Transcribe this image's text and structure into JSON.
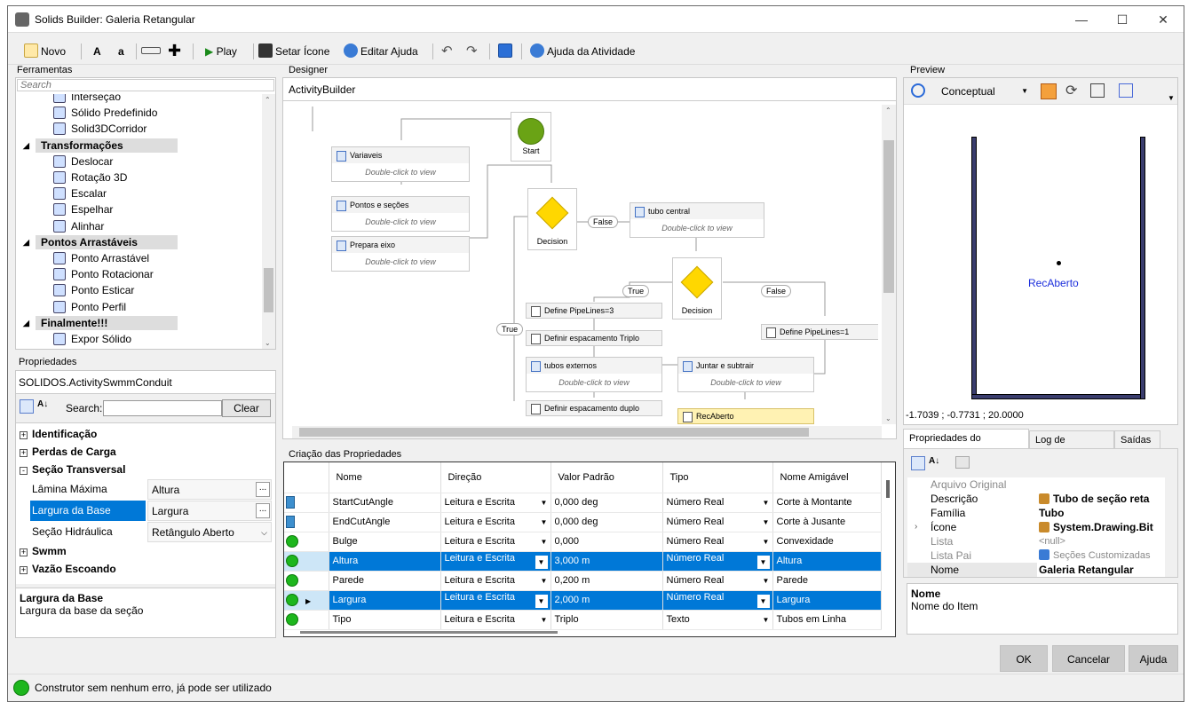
{
  "window": {
    "title": "Solids Builder: Galeria Retangular"
  },
  "toolbar": {
    "novo": "Novo",
    "a_upper": "A",
    "a_lower": "a",
    "play": "Play",
    "setar_icone": "Setar Ícone",
    "editar_ajuda": "Editar Ajuda",
    "ajuda_atividade": "Ajuda da Atividade"
  },
  "ferramentas": {
    "title": "Ferramentas",
    "search_placeholder": "Search",
    "items": [
      {
        "kind": "item",
        "label": "Interseção",
        "icon": "intersect-icon"
      },
      {
        "kind": "item",
        "label": "Sólido Predefinido",
        "icon": "solid-icon"
      },
      {
        "kind": "item",
        "label": "Solid3DCorridor",
        "icon": "gear-icon"
      },
      {
        "kind": "cat",
        "label": "Transformações"
      },
      {
        "kind": "item",
        "label": "Deslocar",
        "icon": "move-icon"
      },
      {
        "kind": "item",
        "label": "Rotação 3D",
        "icon": "rotate-icon"
      },
      {
        "kind": "item",
        "label": "Escalar",
        "icon": "scale-icon"
      },
      {
        "kind": "item",
        "label": "Espelhar",
        "icon": "mirror-icon"
      },
      {
        "kind": "item",
        "label": "Alinhar",
        "icon": "align-icon"
      },
      {
        "kind": "cat",
        "label": "Pontos Arrastáveis"
      },
      {
        "kind": "item",
        "label": "Ponto Arrastável",
        "icon": "drag-point-icon"
      },
      {
        "kind": "item",
        "label": "Ponto Rotacionar",
        "icon": "rotate-point-icon"
      },
      {
        "kind": "item",
        "label": "Ponto Esticar",
        "icon": "stretch-point-icon"
      },
      {
        "kind": "item",
        "label": "Ponto Perfil",
        "icon": "profile-point-icon"
      },
      {
        "kind": "cat",
        "label": "Finalmente!!!"
      },
      {
        "kind": "item",
        "label": "Expor Sólido",
        "icon": "export-icon"
      }
    ]
  },
  "propriedades": {
    "title": "Propriedades",
    "object": "SOLIDOS.ActivitySwmmConduit",
    "search_label": "Search:",
    "clear": "Clear",
    "groups": [
      "Identificação",
      "Perdas de Carga",
      "Seção Transversal",
      "Swmm",
      "Vazão Escoando"
    ],
    "rows": [
      {
        "name": "Lâmina Máxima",
        "value": "Altura"
      },
      {
        "name": "Largura da Base",
        "value": "Largura"
      },
      {
        "name": "Seção Hidráulica",
        "value": "Retângulo Aberto"
      }
    ],
    "desc_title": "Largura da Base",
    "desc_text": "Largura da base da seção"
  },
  "designer": {
    "title": "Designer",
    "breadcrumb": "ActivityBuilder",
    "start": "Start",
    "decision": "Decision",
    "dblclick": "Double-click to view",
    "seq": [
      "Variaveis",
      "Pontos e seções",
      "Prepara eixo"
    ],
    "tubo_central": "tubo central",
    "false": "False",
    "true": "True",
    "pipe3": "Define PipeLines=3",
    "triplo": "Definir espacamento Triplo",
    "tubos_externos": "tubos externos",
    "duplo": "Definir espacamento duplo",
    "juntar": "Juntar e subtrair",
    "pipe1": "Define PipeLines=1",
    "recaberto": "RecAberto"
  },
  "criacao": {
    "title": "Criação das Propriedades",
    "columns": [
      "Nome",
      "Direção",
      "Valor Padrão",
      "Tipo",
      "Nome Amigável"
    ],
    "rows": [
      {
        "icon": "table-icon",
        "nome": "StartCutAngle",
        "direcao": "Leitura e Escrita",
        "valor": "0,000 deg",
        "tipo": "Número Real",
        "amigavel": "Corte à Montante"
      },
      {
        "icon": "table-icon",
        "nome": "EndCutAngle",
        "direcao": "Leitura e Escrita",
        "valor": "0,000 deg",
        "tipo": "Número Real",
        "amigavel": "Corte à Jusante"
      },
      {
        "icon": "green-dot",
        "nome": "Bulge",
        "direcao": "Leitura e Escrita",
        "valor": "0,000",
        "tipo": "Número Real",
        "amigavel": "Convexidade"
      },
      {
        "icon": "green-dot",
        "nome": "Altura",
        "direcao": "Leitura e Escrita",
        "valor": "3,000 m",
        "tipo": "Número Real",
        "amigavel": "Altura",
        "sel": true
      },
      {
        "icon": "green-dot",
        "nome": "Parede",
        "direcao": "Leitura e Escrita",
        "valor": "0,200 m",
        "tipo": "Número Real",
        "amigavel": "Parede"
      },
      {
        "icon": "green-dot",
        "nome": "Largura",
        "direcao": "Leitura e Escrita",
        "valor": "2,000 m",
        "tipo": "Número Real",
        "amigavel": "Largura",
        "sel": true,
        "current": true
      },
      {
        "icon": "green-dot",
        "nome": "Tipo",
        "direcao": "Leitura e Escrita",
        "valor": "Triplo",
        "tipo": "Texto",
        "amigavel": "Tubos em Linha"
      }
    ]
  },
  "preview": {
    "title": "Preview",
    "mode": "Conceptual",
    "label": "RecAberto",
    "coords": "-1.7039 ; -0.7731 ; 20.0000"
  },
  "construtor": {
    "tabs": [
      "Propriedades do Construtor",
      "Log de Execução",
      "Saídas"
    ],
    "rows": [
      {
        "name": "Arquivo Original",
        "value": ""
      },
      {
        "name": "Descrição",
        "value": "Tubo de seção reta"
      },
      {
        "name": "Família",
        "value": "Tubo"
      },
      {
        "name": "Ícone",
        "value": "System.Drawing.Bit"
      },
      {
        "name": "Lista",
        "value": "<null>"
      },
      {
        "name": "Lista Pai",
        "value": "Seções Customizadas"
      },
      {
        "name": "Nome",
        "value": "Galeria Retangular"
      }
    ],
    "desc_title": "Nome",
    "desc_text": "Nome do Item"
  },
  "buttons": {
    "ok": "OK",
    "cancelar": "Cancelar",
    "ajuda": "Ajuda"
  },
  "status": {
    "text": "Construtor sem nenhum erro, já pode ser utilizado",
    "color": "#1db61d"
  }
}
